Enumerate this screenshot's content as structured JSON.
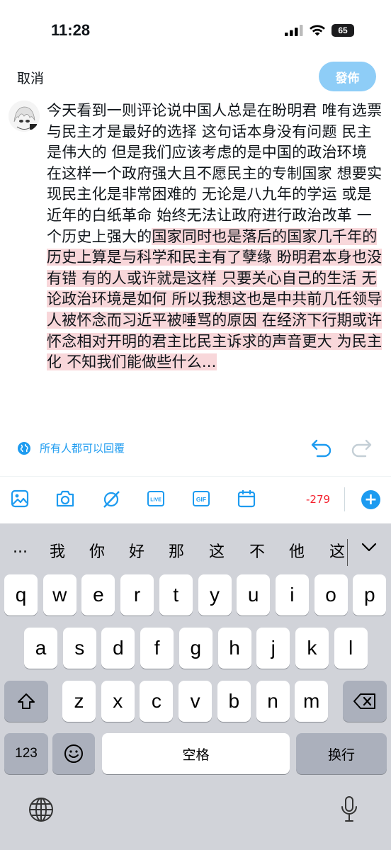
{
  "status_bar": {
    "time": "11:28",
    "battery": "65"
  },
  "header": {
    "cancel_label": "取消",
    "post_label": "發佈"
  },
  "compose": {
    "text_plain": "今天看到一则评论说中国人总是在盼明君 唯有选票与民主才是最好的选择 这句话本身没有问题 民主是伟大的 但是我们应该考虑的是中国的政治环境 在这样一个政府强大且不愿民主的专制国家 想要实现民主化是非常困难的 无论是八九年的学运 或是近年的白纸革命 始终无法让政府进行政治改革 一个历史上强大的",
    "text_overflow": "国家同时也是落后的国家几千年的历史上算是与科学和民主有了孽缘 盼明君本身也没有错 有的人或许就是这样 只要关心自己的生活 无论政治环境是如何 所以我想这也是中共前几任领导人被怀念而习近平被唾骂的原因 在经济下行期或许怀念相对开明的君主比民主诉求的声音更大 为民主化 不知我们能做些什么..."
  },
  "reply_setting": {
    "label": "所有人都可以回覆"
  },
  "toolbar": {
    "icons": [
      "image-icon",
      "camera-icon",
      "grok-icon",
      "live-icon",
      "gif-icon",
      "schedule-icon"
    ],
    "char_count": "-279"
  },
  "keyboard": {
    "candidates": [
      "...",
      "我",
      "你",
      "好",
      "那",
      "这",
      "不",
      "他",
      "这"
    ],
    "row1": [
      "q",
      "w",
      "e",
      "r",
      "t",
      "y",
      "u",
      "i",
      "o",
      "p"
    ],
    "row2": [
      "a",
      "s",
      "d",
      "f",
      "g",
      "h",
      "j",
      "k",
      "l"
    ],
    "row3": [
      "z",
      "x",
      "c",
      "v",
      "b",
      "n",
      "m"
    ],
    "numbers_label": "123",
    "space_label": "空格",
    "return_label": "换行"
  }
}
